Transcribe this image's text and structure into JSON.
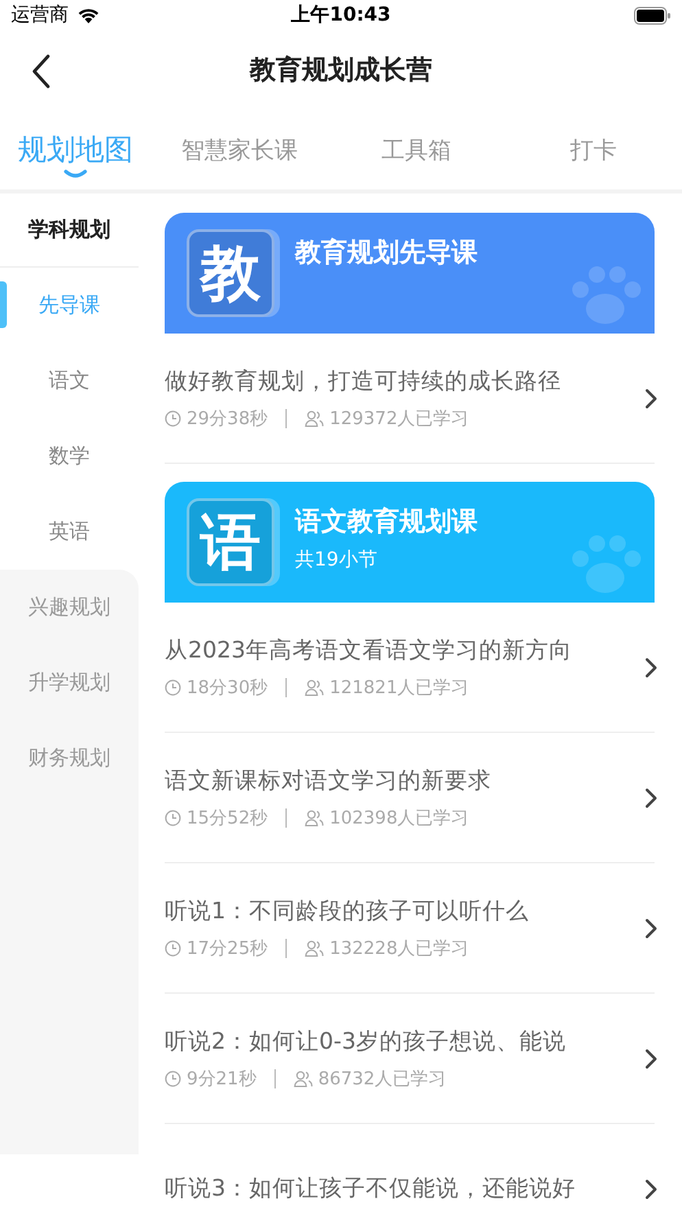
{
  "status_bar": {
    "carrier": "运营商",
    "time": "上午10:43"
  },
  "nav": {
    "title": "教育规划成长营"
  },
  "tabs": [
    {
      "label": "规划地图",
      "selected": true
    },
    {
      "label": "智慧家长课",
      "selected": false
    },
    {
      "label": "工具箱",
      "selected": false
    },
    {
      "label": "打卡",
      "selected": false
    }
  ],
  "sidebar": {
    "sections": [
      {
        "title": "学科规划",
        "expanded": true,
        "items": [
          {
            "label": "先导课",
            "selected": true
          },
          {
            "label": "语文",
            "selected": false
          },
          {
            "label": "数学",
            "selected": false
          },
          {
            "label": "英语",
            "selected": false
          }
        ]
      },
      {
        "title": "兴趣规划",
        "expanded": false
      },
      {
        "title": "升学规划",
        "expanded": false
      },
      {
        "title": "财务规划",
        "expanded": false
      }
    ]
  },
  "courses": [
    {
      "badge": "教",
      "title": "教育规划先导课",
      "color": "#4a8ff8",
      "lessons": [
        {
          "title": "做好教育规划，打造可持续的成长路径",
          "duration": "29分38秒",
          "learners": "129372人已学习"
        }
      ]
    },
    {
      "badge": "语",
      "title": "语文教育规划课",
      "subtitle": "共19小节",
      "color": "#1ab9fb",
      "lessons": [
        {
          "title": "从2023年高考语文看语文学习的新方向",
          "duration": "18分30秒",
          "learners": "121821人已学习"
        },
        {
          "title": "语文新课标对语文学习的新要求",
          "duration": "15分52秒",
          "learners": "102398人已学习"
        },
        {
          "title": "听说1：不同龄段的孩子可以听什么",
          "duration": "17分25秒",
          "learners": "132228人已学习"
        },
        {
          "title": "听说2：如何让0-3岁的孩子想说、能说",
          "duration": "9分21秒",
          "learners": "86732人已学习"
        },
        {
          "title": "听说3：如何让孩子不仅能说，还能说好"
        }
      ]
    }
  ]
}
